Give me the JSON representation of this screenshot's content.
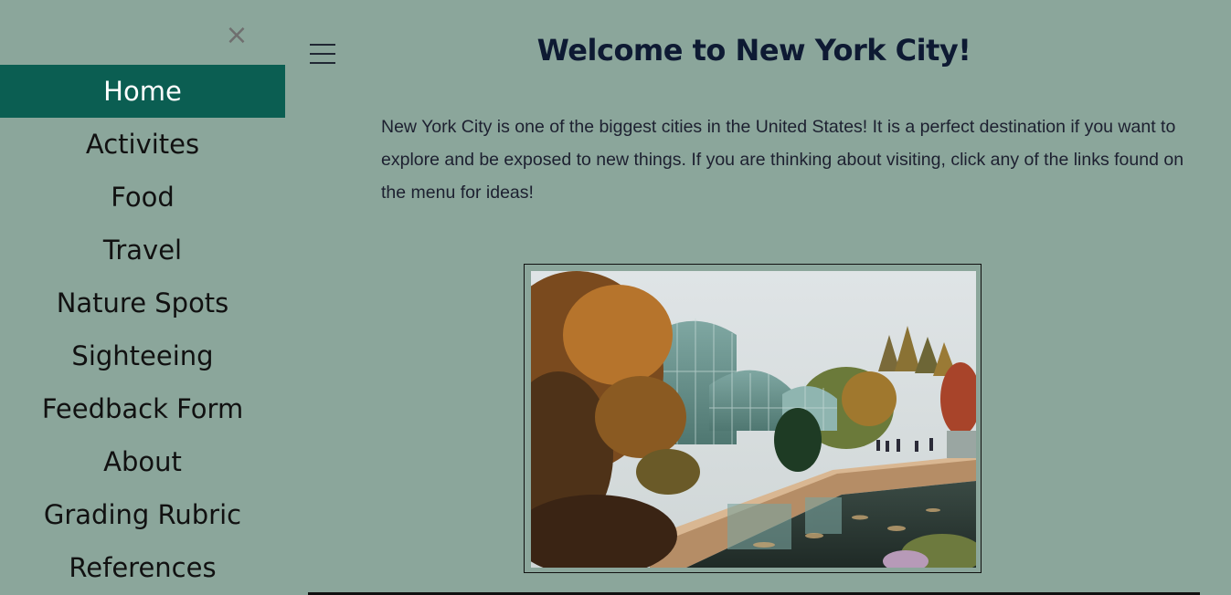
{
  "sidebar": {
    "close_symbol": "×",
    "items": [
      {
        "label": "Home",
        "active": true
      },
      {
        "label": "Activites",
        "active": false
      },
      {
        "label": "Food",
        "active": false
      },
      {
        "label": "Travel",
        "active": false
      },
      {
        "label": "Nature Spots",
        "active": false
      },
      {
        "label": "Sighteeing",
        "active": false
      },
      {
        "label": "Feedback Form",
        "active": false
      },
      {
        "label": "About",
        "active": false
      },
      {
        "label": "Grading Rubric",
        "active": false
      },
      {
        "label": "References",
        "active": false
      }
    ]
  },
  "header": {
    "menu_icon": "hamburger-icon",
    "title": "Welcome to New York City!"
  },
  "main": {
    "intro": "New York City is one of the biggest cities in the United States! It is a perfect destination if you want to explore and be exposed to new things. If you are thinking about visiting, click any of the links found on the menu for ideas!",
    "photo_subject": "botanic-garden-conservatory"
  },
  "colors": {
    "page_background": "#8ba69b",
    "active_nav_background": "#0b5e52",
    "active_nav_text": "#ffffff",
    "title_text": "#0e1a33"
  }
}
